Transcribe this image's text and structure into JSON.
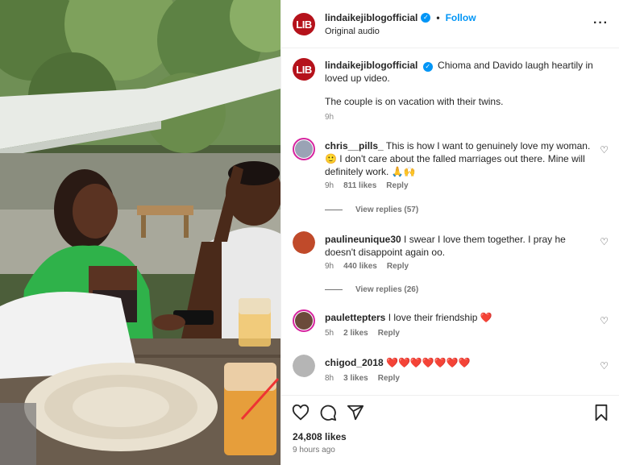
{
  "post": {
    "username": "lindaikejiblogofficial",
    "follow_label": "Follow",
    "separator": "•",
    "audio": "Original audio",
    "avatar_text": "LIB",
    "brand_color": "#b5121b",
    "accent_color": "#0095f6"
  },
  "caption": {
    "username": "lindaikejiblogofficial",
    "text": "Chioma and Davido laugh heartily in loved up video.",
    "line2": "The couple is on vacation with their twins.",
    "time": "9h"
  },
  "comments": [
    {
      "username": "chris__pills_",
      "text": "This is how I want to genuinely love my woman. 🙂 I don't care about the falled marriages out there. Mine will definitely work. 🙏🙌",
      "time": "9h",
      "likes": "811 likes",
      "reply": "Reply",
      "view_replies": "View replies (57)"
    },
    {
      "username": "paulineunique30",
      "text": "I swear I love them together. I pray he doesn't disappoint again oo.",
      "time": "9h",
      "likes": "440 likes",
      "reply": "Reply",
      "view_replies": "View replies (26)"
    },
    {
      "username": "paulettepters",
      "text": "I love their friendship ❤️",
      "time": "5h",
      "likes": "2 likes",
      "reply": "Reply"
    },
    {
      "username": "chigod_2018",
      "text": "❤️❤️❤️❤️❤️❤️❤️",
      "time": "8h",
      "likes": "3 likes",
      "reply": "Reply"
    }
  ],
  "footer": {
    "likes": "24,808 likes",
    "ago": "9 hours ago"
  },
  "icons": {
    "more": "more-icon",
    "like": "heart-icon",
    "comment": "comment-icon",
    "share": "share-icon",
    "save": "bookmark-icon"
  }
}
